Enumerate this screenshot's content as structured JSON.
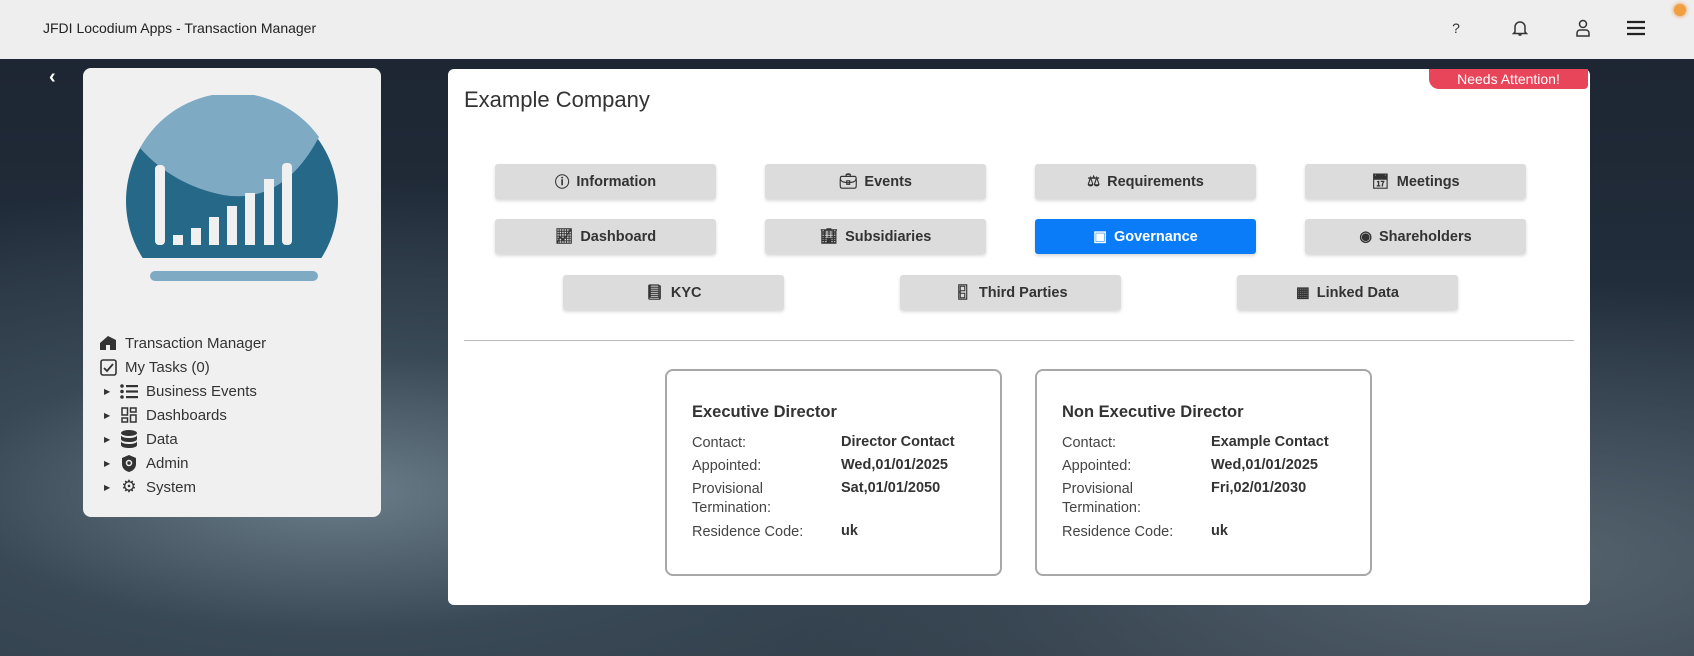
{
  "header": {
    "title": "JFDI Locodium Apps - Transaction Manager",
    "help": "?"
  },
  "sidebar": {
    "items": [
      {
        "label": "Transaction Manager",
        "icon": "house-icon"
      },
      {
        "label": "My Tasks (0)",
        "icon": "checkbox-icon"
      },
      {
        "label": "Business Events",
        "icon": "list-icon"
      },
      {
        "label": "Dashboards",
        "icon": "dashboard-icon"
      },
      {
        "label": "Data",
        "icon": "database-icon"
      },
      {
        "label": "Admin",
        "icon": "shield-icon"
      },
      {
        "label": "System",
        "icon": "gear-icon"
      }
    ]
  },
  "main": {
    "badge": "Needs Attention!",
    "company": "Example Company",
    "tabs": [
      {
        "label": "Information",
        "icon": "info-icon"
      },
      {
        "label": "Events",
        "icon": "briefcase-icon"
      },
      {
        "label": "Requirements",
        "icon": "scale-icon"
      },
      {
        "label": "Meetings",
        "icon": "calendar-icon"
      },
      {
        "label": "Dashboard",
        "icon": "chart-line-icon"
      },
      {
        "label": "Subsidiaries",
        "icon": "building-icon"
      },
      {
        "label": "Governance",
        "icon": "presenter-icon",
        "active": true
      },
      {
        "label": "Shareholders",
        "icon": "money-icon"
      },
      {
        "label": "KYC",
        "icon": "book-icon"
      },
      {
        "label": "Third Parties",
        "icon": "door-icon"
      },
      {
        "label": "Linked Data",
        "icon": "linked-data-icon"
      }
    ],
    "labels": {
      "contact": "Contact:",
      "appointed": "Appointed:",
      "prov1": "Provisional",
      "prov2": "Termination:",
      "residence": "Residence Code:"
    },
    "cards": [
      {
        "title": "Executive Director",
        "contact": "Director Contact",
        "appointed": "Wed,01/01/2025",
        "termination": "Sat,01/01/2050",
        "residence": "uk"
      },
      {
        "title": "Non Executive Director",
        "contact": "Example Contact",
        "appointed": "Wed,01/01/2025",
        "termination": "Fri,02/01/2030",
        "residence": "uk"
      }
    ]
  },
  "colors": {
    "accent": "#0a7cf8",
    "badge": "#e8455a",
    "logo_dark": "#256887",
    "logo_light": "#7eaac4"
  }
}
